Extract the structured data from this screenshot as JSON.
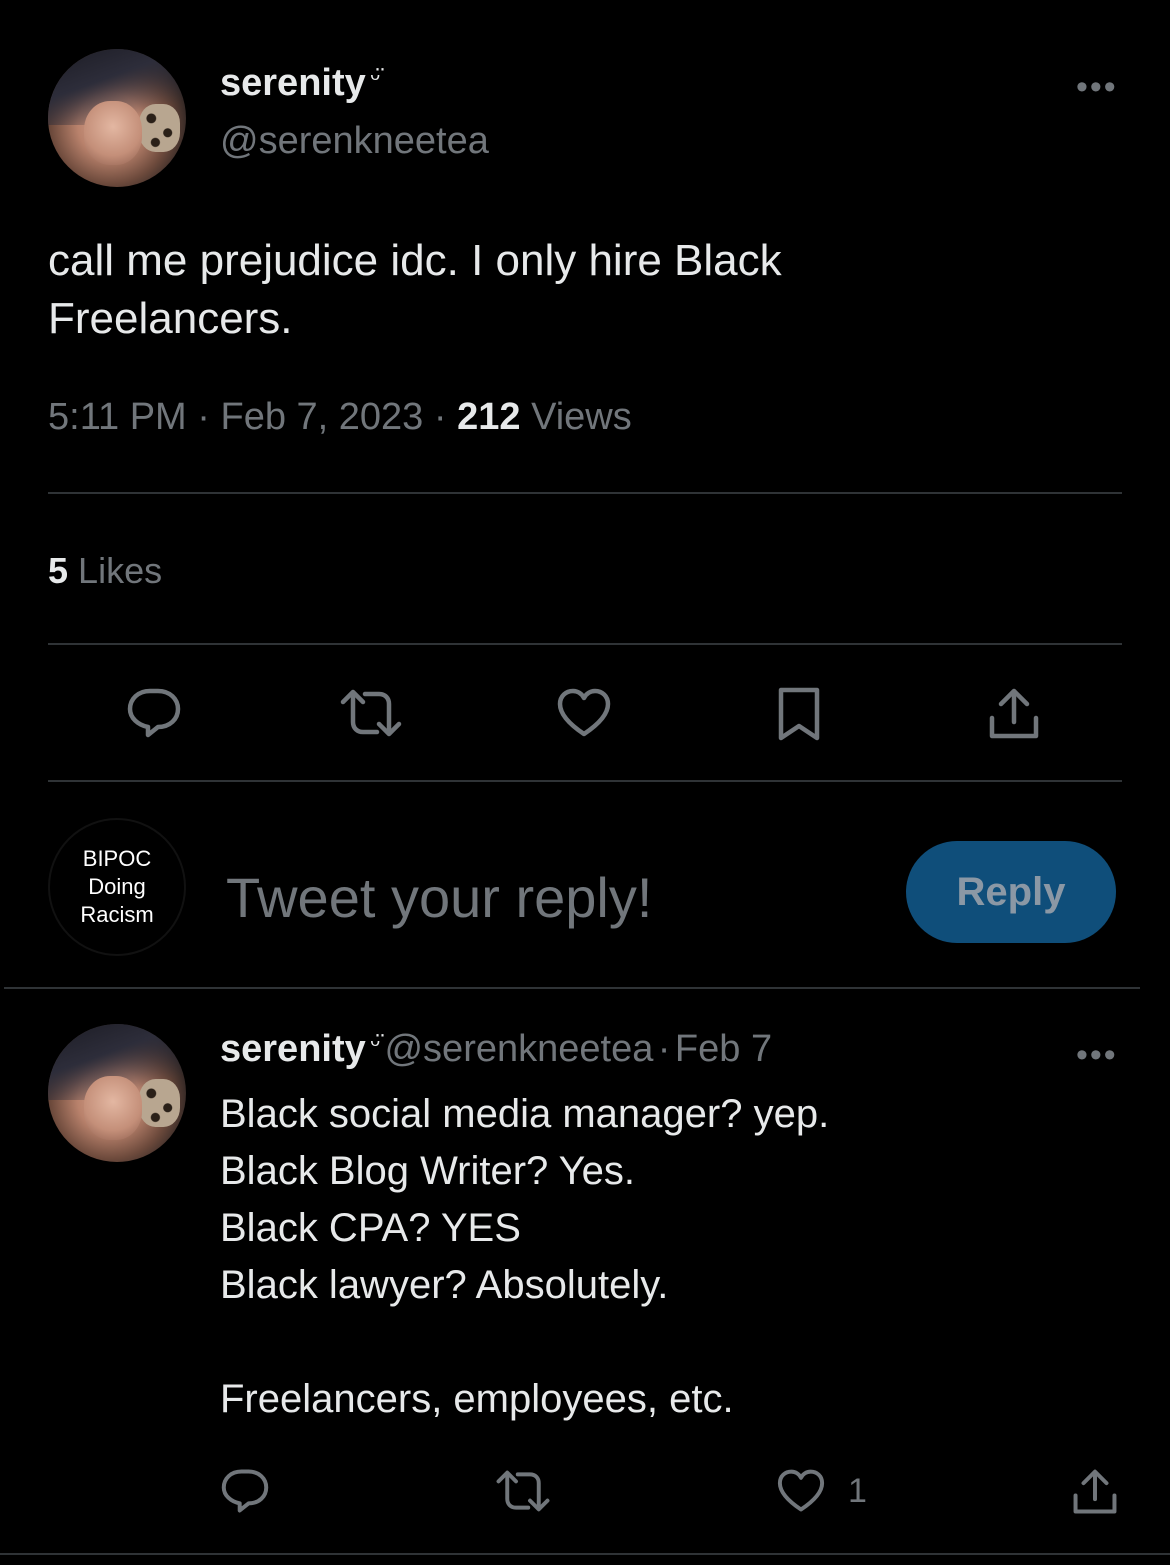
{
  "main_tweet": {
    "author_name": "serenity",
    "name_emoji": "ᵕ̈",
    "handle": "@serenkneetea",
    "more_icon": "ellipsis-icon",
    "text": "call me prejudice idc. I only hire Black Freelancers.",
    "time": "5:11 PM",
    "date": "Feb 7, 2023",
    "separator": "·",
    "views_count": "212",
    "views_label": "Views",
    "likes_count": "5",
    "likes_label": "Likes",
    "actions": [
      "reply-icon",
      "retweet-icon",
      "like-icon",
      "bookmark-icon",
      "share-icon"
    ]
  },
  "composer": {
    "avatar_text": "BIPOC\nDoing\nRacism",
    "placeholder": "Tweet your reply!",
    "button_label": "Reply",
    "button_color": "#0f4e7a"
  },
  "reply_tweet": {
    "author_name": "serenity",
    "name_emoji": "ᵕ̈",
    "handle": "@serenkneetea",
    "date": "Feb 7",
    "separator": "·",
    "text": "Black social media manager? yep.\nBlack Blog Writer? Yes.\nBlack CPA? YES\nBlack lawyer? Absolutely.\n\nFreelancers, employees, etc.",
    "like_count": "1",
    "actions": [
      "reply-icon",
      "retweet-icon",
      "like-icon",
      "share-icon"
    ]
  },
  "colors": {
    "background": "#000000",
    "text_primary": "#e7e9ea",
    "text_secondary": "#71767b",
    "divider": "#2f3336"
  }
}
